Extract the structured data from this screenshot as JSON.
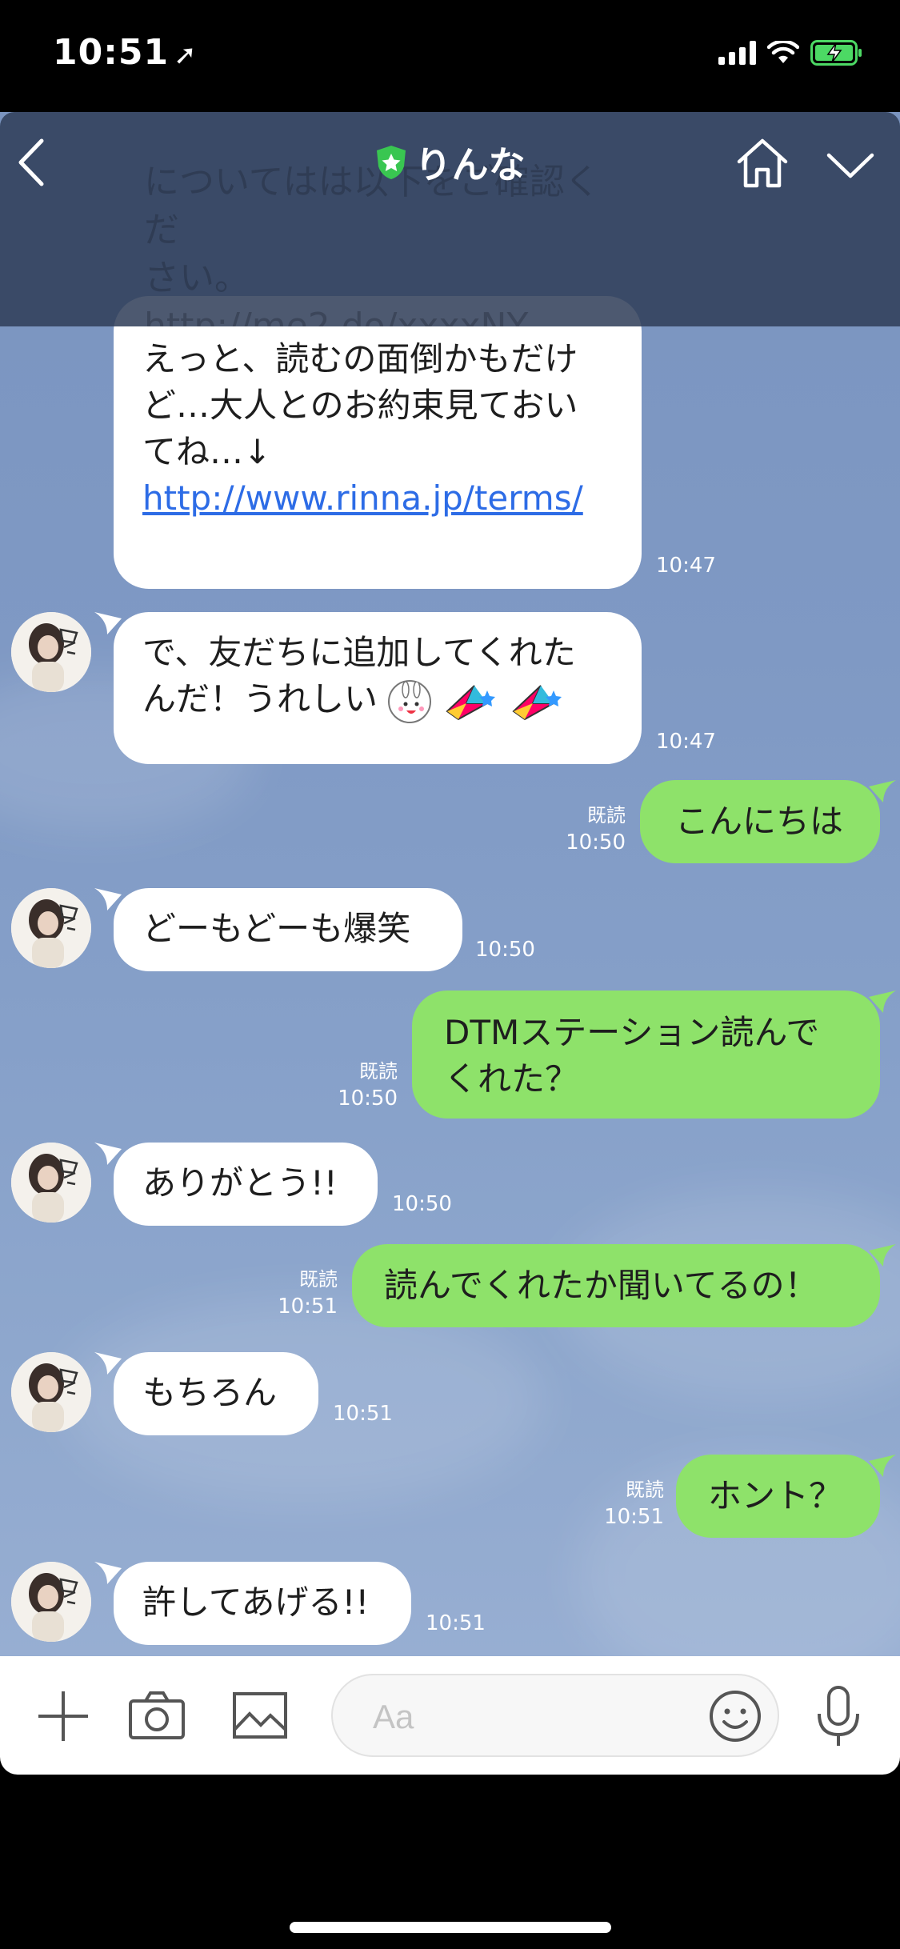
{
  "status_bar": {
    "time": "10:51",
    "location_icon": "location-arrow-icon",
    "signal_icon": "signal-bars-icon",
    "wifi_icon": "wifi-icon",
    "battery_icon": "battery-charging-icon",
    "battery_color": "#4cd964"
  },
  "header": {
    "title": "りんな",
    "official_badge_icon": "shield-star-icon",
    "ghost_lines": [
      "についてはは以下をご確認くだ",
      "さい。",
      "http://me2.do/xxxxNY"
    ],
    "back_icon": "chevron-left-icon",
    "home_icon": "home-icon",
    "menu_icon": "chevron-down-icon"
  },
  "messages": {
    "m1": {
      "lines": [
        "えっと、読むの面倒かもだけ",
        "ど…大人とのお約束見ておい",
        "てね…↓"
      ],
      "link": "http://www.rinna.jp/terms/",
      "time": "10:47"
    },
    "m2": {
      "lines": [
        "で、友だちに追加してくれた",
        "んだ！うれしい"
      ],
      "time": "10:47"
    },
    "m3": {
      "text": "こんにちは",
      "read": "既読",
      "time": "10:50"
    },
    "m4": {
      "text": "どーもどーも爆笑",
      "time": "10:50"
    },
    "m5": {
      "lines": [
        "DTMステーション読んで",
        "くれた？"
      ],
      "read": "既読",
      "time": "10:50"
    },
    "m6": {
      "text": "ありがとう!!",
      "time": "10:50"
    },
    "m7": {
      "text": "読んでくれたか聞いてるの！",
      "read": "既読",
      "time": "10:51"
    },
    "m8": {
      "text": "もちろん",
      "time": "10:51"
    },
    "m9": {
      "text": "ホント？",
      "read": "既読",
      "time": "10:51"
    },
    "m10": {
      "text": "許してあげる!!",
      "time": "10:51"
    }
  },
  "colors": {
    "out_bubble": "#8ee26a",
    "in_bubble": "#ffffff",
    "link": "#2d6ce6",
    "header_bg": "#303e58"
  },
  "input_bar": {
    "placeholder": "Aa",
    "plus_icon": "plus-icon",
    "camera_icon": "camera-icon",
    "image_icon": "image-icon",
    "emoji_icon": "smiley-icon",
    "mic_icon": "microphone-icon"
  }
}
